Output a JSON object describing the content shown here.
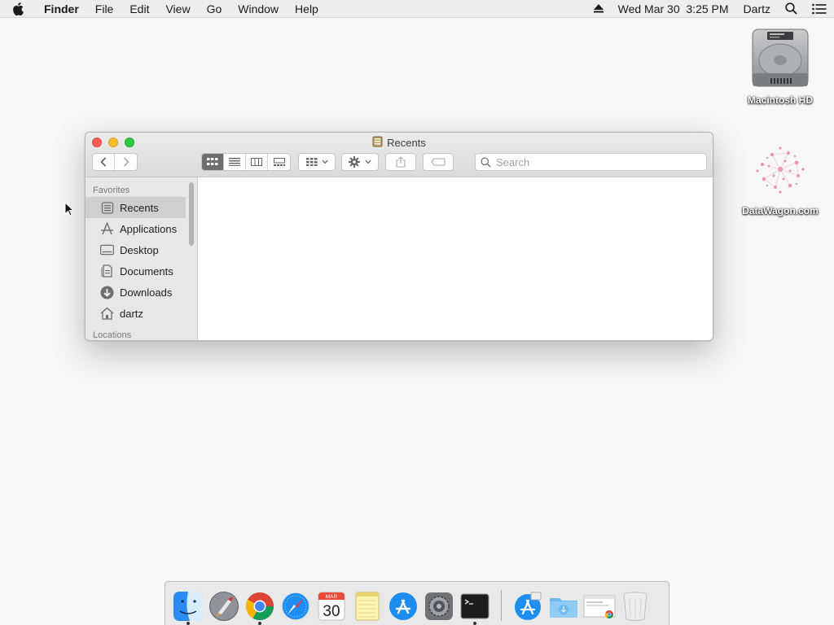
{
  "menubar": {
    "app_name": "Finder",
    "menus": [
      "File",
      "Edit",
      "View",
      "Go",
      "Window",
      "Help"
    ],
    "datetime": "Wed Mar 30  3:25 PM",
    "user": "Dartz"
  },
  "desktop": {
    "icons": [
      {
        "label": "Macintosh HD",
        "icon": "hard-drive-icon"
      },
      {
        "label": "DataWagon.com",
        "icon": "datawagon-logo-icon"
      }
    ]
  },
  "finder": {
    "title": "Recents",
    "search_placeholder": "Search",
    "sidebar": {
      "favorites_heading": "Favorites",
      "items": [
        {
          "label": "Recents",
          "icon": "recents-icon",
          "selected": true
        },
        {
          "label": "Applications",
          "icon": "applications-icon",
          "selected": false
        },
        {
          "label": "Desktop",
          "icon": "desktop-icon",
          "selected": false
        },
        {
          "label": "Documents",
          "icon": "documents-icon",
          "selected": false
        },
        {
          "label": "Downloads",
          "icon": "downloads-icon",
          "selected": false
        },
        {
          "label": "dartz",
          "icon": "home-icon",
          "selected": false
        }
      ],
      "locations_heading": "Locations"
    }
  },
  "dock": {
    "apps": [
      {
        "name": "Finder",
        "icon": "finder-icon",
        "running": true
      },
      {
        "name": "Launchpad",
        "icon": "launchpad-icon",
        "running": false
      },
      {
        "name": "Google Chrome",
        "icon": "chrome-icon",
        "running": true
      },
      {
        "name": "Safari",
        "icon": "safari-icon",
        "running": false
      },
      {
        "name": "Calendar",
        "icon": "calendar-icon",
        "running": false,
        "month": "MAR",
        "day": "30"
      },
      {
        "name": "Notes",
        "icon": "notes-icon",
        "running": false
      },
      {
        "name": "App Store",
        "icon": "app-store-icon",
        "running": false
      },
      {
        "name": "System Preferences",
        "icon": "system-preferences-icon",
        "running": false
      },
      {
        "name": "Terminal",
        "icon": "terminal-icon",
        "running": true
      },
      {
        "name": "Applications",
        "icon": "applications-stack-icon",
        "running": false
      },
      {
        "name": "Downloads",
        "icon": "downloads-stack-icon",
        "running": false
      },
      {
        "name": "Recent Document",
        "icon": "document-thumbnail-icon",
        "running": false
      },
      {
        "name": "Trash",
        "icon": "trash-icon",
        "running": false
      }
    ]
  },
  "colors": {
    "close": "#fd5e56",
    "minimize": "#fdbc2e",
    "maximize": "#29c940",
    "selection": "#cfcfcf"
  }
}
